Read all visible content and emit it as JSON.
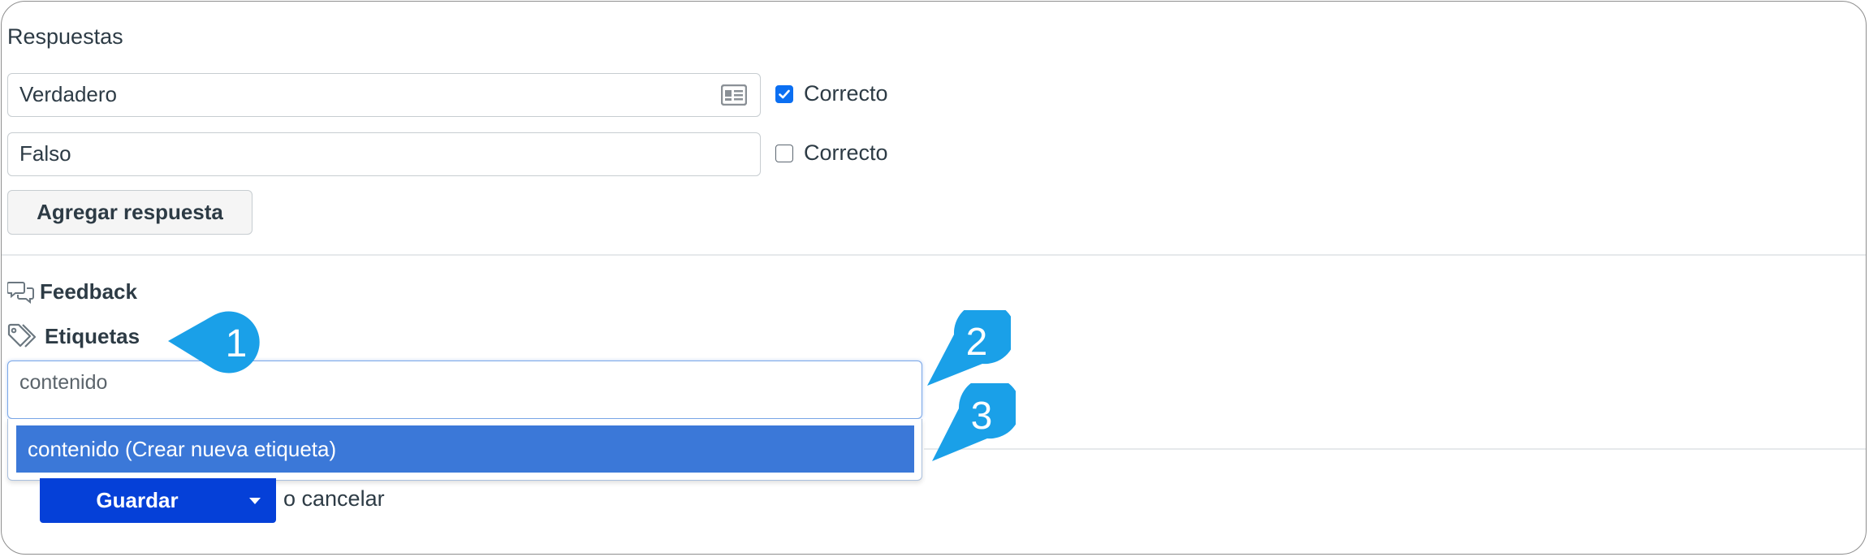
{
  "answers_section": {
    "title": "Respuestas",
    "answers": [
      {
        "text": "Verdadero",
        "correct_label": "Correcto",
        "correct": true
      },
      {
        "text": "Falso",
        "correct_label": "Correcto",
        "correct": false
      }
    ],
    "add_answer_label": "Agregar respuesta"
  },
  "feedback": {
    "label": "Feedback",
    "icon": "chat-bubbles-icon"
  },
  "tags": {
    "label": "Etiquetas",
    "icon": "tags-icon",
    "input_value": "contenido",
    "dropdown_option": "contenido (Crear nueva etiqueta)"
  },
  "actions": {
    "save_label": "Guardar",
    "cancel_text": "o cancelar"
  },
  "callouts": [
    "1",
    "2",
    "3"
  ],
  "colors": {
    "accent_blue": "#0540d8",
    "highlight": "#3b78d8",
    "callout": "#1aa0e8",
    "checkbox": "#0b6ff2"
  }
}
